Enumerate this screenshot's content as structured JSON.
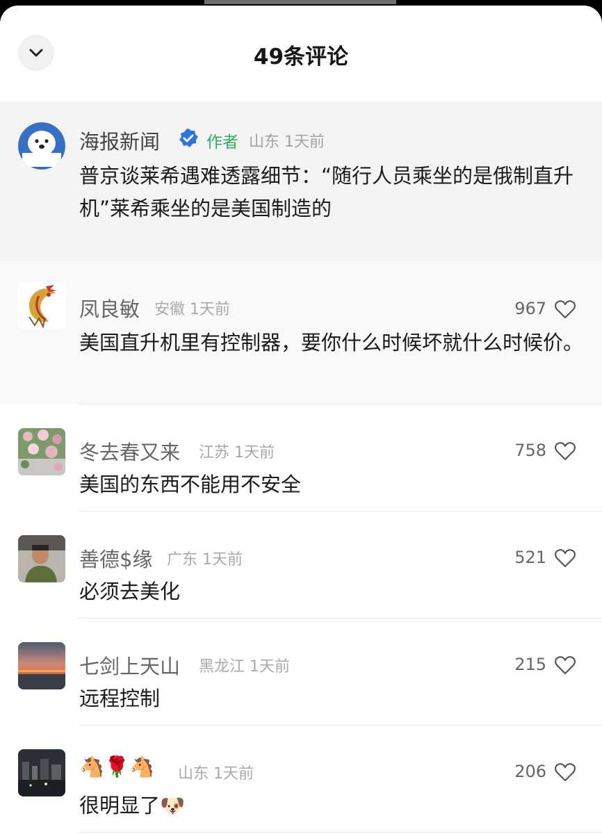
{
  "sheet": {
    "title": "49条评论",
    "collapse_icon": "chevron-down-icon"
  },
  "author_post": {
    "name": "海报新闻",
    "badge": "作者",
    "meta_region": "山东",
    "meta_time": "1天前",
    "text": "普京谈莱希遇难透露细节：“随行人员乘坐的是俄制直升机”莱希乘坐的是美国制造的",
    "verified_icon": "verified-check-icon",
    "accent_color": "#2fae5b"
  },
  "comments": [
    {
      "name": "凤良敏",
      "region": "安徽",
      "time": "1天前",
      "likes": "967",
      "text": "美国直升机里有控制器，要你什么时候坏就什么时候价。"
    },
    {
      "name": "冬去春又来",
      "region": "江苏",
      "time": "1天前",
      "likes": "758",
      "text": "美国的东西不能用不安全"
    },
    {
      "name": "善德$缘",
      "region": "广东",
      "time": "1天前",
      "likes": "521",
      "text": "必须去美化"
    },
    {
      "name": "七剑上天山",
      "region": "黑龙江",
      "time": "1天前",
      "likes": "215",
      "text": "远程控制"
    },
    {
      "name": "🐴🌹🐴",
      "region": "山东",
      "time": "1天前",
      "likes": "206",
      "text": "很明显了🐶"
    }
  ],
  "icons": {
    "like": "heart-outline-icon"
  }
}
